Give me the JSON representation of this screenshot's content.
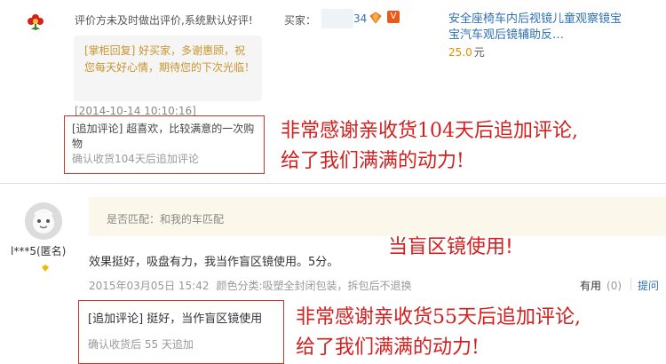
{
  "review1": {
    "text": "评价方未及时做出评价,系统默认好评!",
    "buyer_label": "买家：",
    "buyer_suffix": "34",
    "vip_badge": "V",
    "reply": "[掌柜回复] 好买家，多谢惠顾，祝您每天好心情，期待您的下次光临！",
    "reply_date": "[2014-10-14 10:10:16]",
    "followup_tag": "[追加评论]",
    "followup_text": "超喜欢，比较满意的一次购物",
    "followup_confirm": "确认收货104天后追加评论"
  },
  "product": {
    "title": "安全座椅车内后视镜儿童观察镜宝宝汽车观后镜辅助反…",
    "price": "25.0",
    "unit": "元"
  },
  "review2": {
    "nickname": "l***5(匿名)",
    "match_label": "是否匹配：和我的车匹配",
    "content": "效果挺好，吸盘有力，我当作盲区镜使用。5分。",
    "date": "2015年03月05日 15:42",
    "attr": "颜色分类:吸塑全封闭包装，拆包后不退换",
    "useful_label": "有用",
    "useful_count": "(0)",
    "ask_label": "提问",
    "followup_tag": "[追加评论]",
    "followup_text": "挺好，当作盲区镜使用",
    "followup_confirm": "确认收货后 55 天追加"
  },
  "annotations": {
    "a1_line1": "非常感谢亲收货104天后追加评论,",
    "a1_line2": "给了我们满满的动力!",
    "a2": "当盲区镜使用!",
    "a3_line1": "非常感谢亲收货55天后追加评论,",
    "a3_line2": "给了我们满满的动力!"
  },
  "colors": {
    "link": "#2f6fb6",
    "reply": "#c9952e",
    "price": "#f08a00",
    "annotation": "#d3201f",
    "match_bg": "#fbf7ea"
  },
  "icons": [
    "tmall-buyer-icon",
    "diamond-level-icon",
    "vip-icon",
    "default-avatar-icon",
    "member-badge-icon"
  ]
}
